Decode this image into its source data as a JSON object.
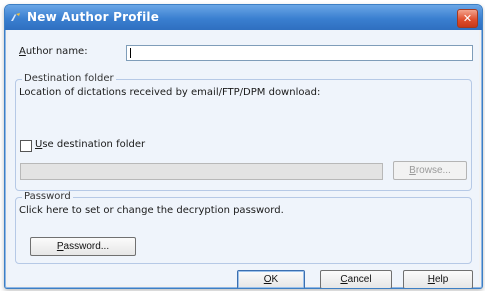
{
  "window": {
    "title": "New Author Profile",
    "close_glyph": "✕"
  },
  "author": {
    "label_first": "A",
    "label_rest": "uthor name:",
    "value": ""
  },
  "destination": {
    "legend": "Destination folder",
    "description": "Location of dictations received by email/FTP/DPM download:",
    "checkbox_first": "U",
    "checkbox_rest": "se destination folder",
    "checked": false,
    "path_value": "",
    "browse_first": "B",
    "browse_rest": "rowse..."
  },
  "password": {
    "legend": "Password",
    "description": "Click here to set or change the decryption password.",
    "button_first": "P",
    "button_rest": "assword..."
  },
  "footer": {
    "ok_first": "O",
    "ok_rest": "K",
    "cancel_first": "C",
    "cancel_rest": "ancel",
    "help_first": "H",
    "help_rest": "elp"
  },
  "colors": {
    "titlebar": "#3a7fd0",
    "close": "#e0502f",
    "group_border": "#b6c9e6"
  }
}
